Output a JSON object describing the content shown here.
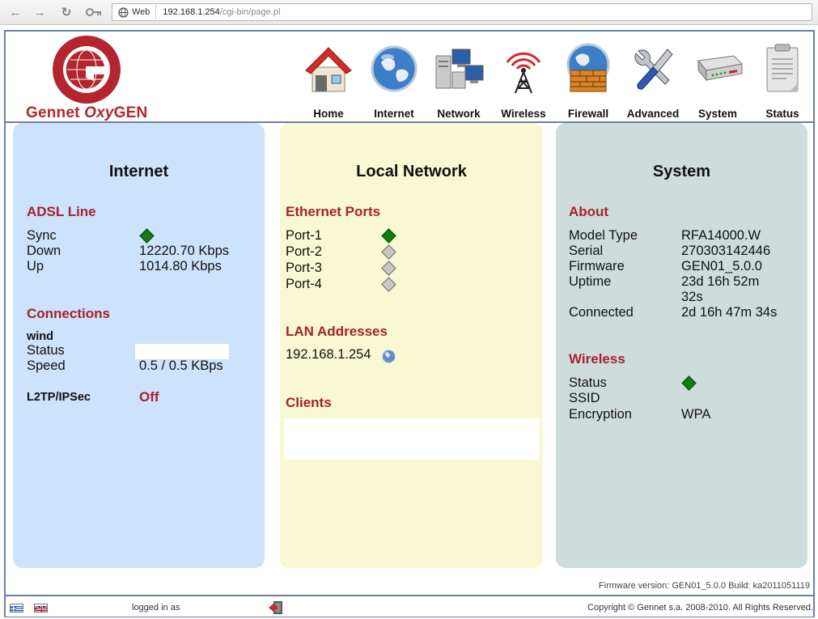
{
  "browser": {
    "chip_label": "Web",
    "url_host": "192.168.1.254",
    "url_path": "/cgi-bin/page.pl"
  },
  "brand": {
    "name_a": "Gennet ",
    "name_b": "Oxy",
    "name_c": "GEN",
    "accent_color": "#b3262f"
  },
  "nav": {
    "items": [
      {
        "label": "Home",
        "icon": "house-icon"
      },
      {
        "label": "Internet",
        "icon": "globe-icon"
      },
      {
        "label": "Network",
        "icon": "computers-icon"
      },
      {
        "label": "Wireless",
        "icon": "antenna-icon"
      },
      {
        "label": "Firewall",
        "icon": "firewall-globe-icon"
      },
      {
        "label": "Advanced",
        "icon": "tools-icon"
      },
      {
        "label": "System",
        "icon": "modem-icon"
      },
      {
        "label": "Status",
        "icon": "clipboard-icon"
      }
    ]
  },
  "internet": {
    "title": "Internet",
    "adsl": {
      "heading": "ADSL Line",
      "sync_label": "Sync",
      "sync_state": "on",
      "down_label": "Down",
      "down_value": "12220.70 Kbps",
      "up_label": "Up",
      "up_value": "1014.80 Kbps"
    },
    "connections": {
      "heading": "Connections",
      "name": "wind",
      "status_label": "Status",
      "status_value": "",
      "speed_label": "Speed",
      "speed_value": "0.5 / 0.5 KBps"
    },
    "l2tp": {
      "label": "L2TP/IPSec",
      "value": "Off"
    }
  },
  "local": {
    "title": "Local Network",
    "ethernet": {
      "heading": "Ethernet Ports",
      "ports": [
        {
          "label": "Port-1",
          "state": "on"
        },
        {
          "label": "Port-2",
          "state": "off"
        },
        {
          "label": "Port-3",
          "state": "off"
        },
        {
          "label": "Port-4",
          "state": "off"
        }
      ]
    },
    "lan": {
      "heading": "LAN Addresses",
      "address": "192.168.1.254"
    },
    "clients": {
      "heading": "Clients"
    }
  },
  "system": {
    "title": "System",
    "about": {
      "heading": "About",
      "model_label": "Model Type",
      "model_value": "RFA14000.W",
      "serial_label": "Serial",
      "serial_value": "270303142446",
      "firmware_label": "Firmware",
      "firmware_value": "GEN01_5.0.0",
      "uptime_label": "Uptime",
      "uptime_value_1": "23d 16h 52m",
      "uptime_value_2": "32s",
      "connected_label": "Connected",
      "connected_value": "2d 16h 47m 34s"
    },
    "wireless": {
      "heading": "Wireless",
      "status_label": "Status",
      "status_state": "on",
      "ssid_label": "SSID",
      "ssid_value": "",
      "encryption_label": "Encryption",
      "encryption_value": "WPA"
    }
  },
  "footer": {
    "firmware_text": "Firmware version: GEN01_5.0.0 Build: ka2011051119",
    "logged_in_text": "logged in as",
    "copyright": "Copyright © Gennet s.a. 2008-2010. All Rights Reserved.",
    "flags": [
      "greek-flag-icon",
      "uk-flag-icon"
    ]
  }
}
